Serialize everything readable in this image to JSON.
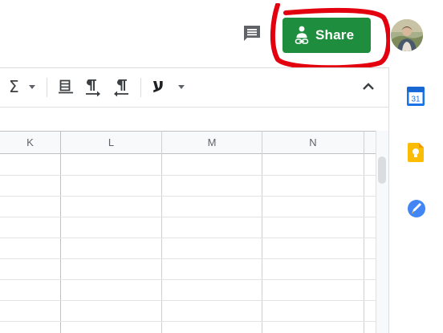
{
  "header": {
    "share_label": "Share",
    "comment_icon": "comment-icon",
    "avatar_icon": "account-avatar"
  },
  "toolbar": {
    "icons": [
      "sigma-functions-icon",
      "dropdown-arrow-icon",
      "text-wrapping-icon",
      "ltr-direction-icon",
      "rtl-direction-icon",
      "hebrew-text-icon",
      "dropdown-arrow-icon",
      "collapse-toolbar-icon"
    ],
    "function_glyph": "Σ",
    "hebrew_glyph": "ע"
  },
  "grid": {
    "columns": [
      "K",
      "L",
      "M",
      "N"
    ]
  },
  "side_panel": {
    "apps": [
      {
        "name": "Calendar",
        "icon": "calendar-icon",
        "date": "31"
      },
      {
        "name": "Keep",
        "icon": "keep-icon"
      },
      {
        "name": "Tasks",
        "icon": "tasks-icon"
      }
    ]
  },
  "colors": {
    "share_button": "#1e8e3e",
    "annotation_stroke": "#e3000f",
    "calendar_blue": "#1a73e8",
    "keep_yellow": "#fbbc04",
    "tasks_blue": "#4285f4"
  }
}
